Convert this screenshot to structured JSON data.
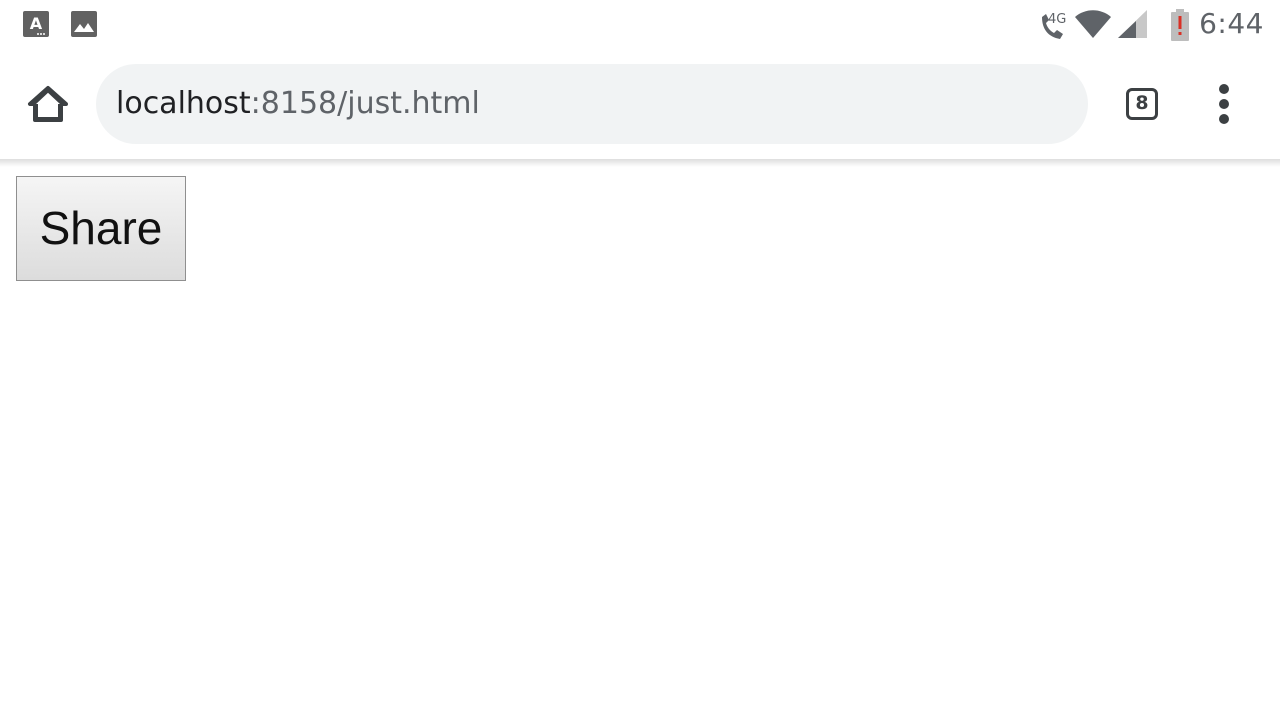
{
  "status_bar": {
    "time": "6:44",
    "network_label": "4G",
    "left_icons": [
      "text-notification-icon",
      "image-notification-icon"
    ],
    "right_icons": [
      "call-4g-icon",
      "wifi-icon",
      "cell-signal-icon",
      "battery-alert-icon"
    ],
    "battery_alert_color": "#d93025"
  },
  "browser": {
    "url_host": "localhost",
    "url_rest": ":8158/just.html",
    "tab_count": "8",
    "icons": [
      "home-icon",
      "tabs-icon",
      "more-vert-icon"
    ]
  },
  "page": {
    "share_label": "Share"
  }
}
